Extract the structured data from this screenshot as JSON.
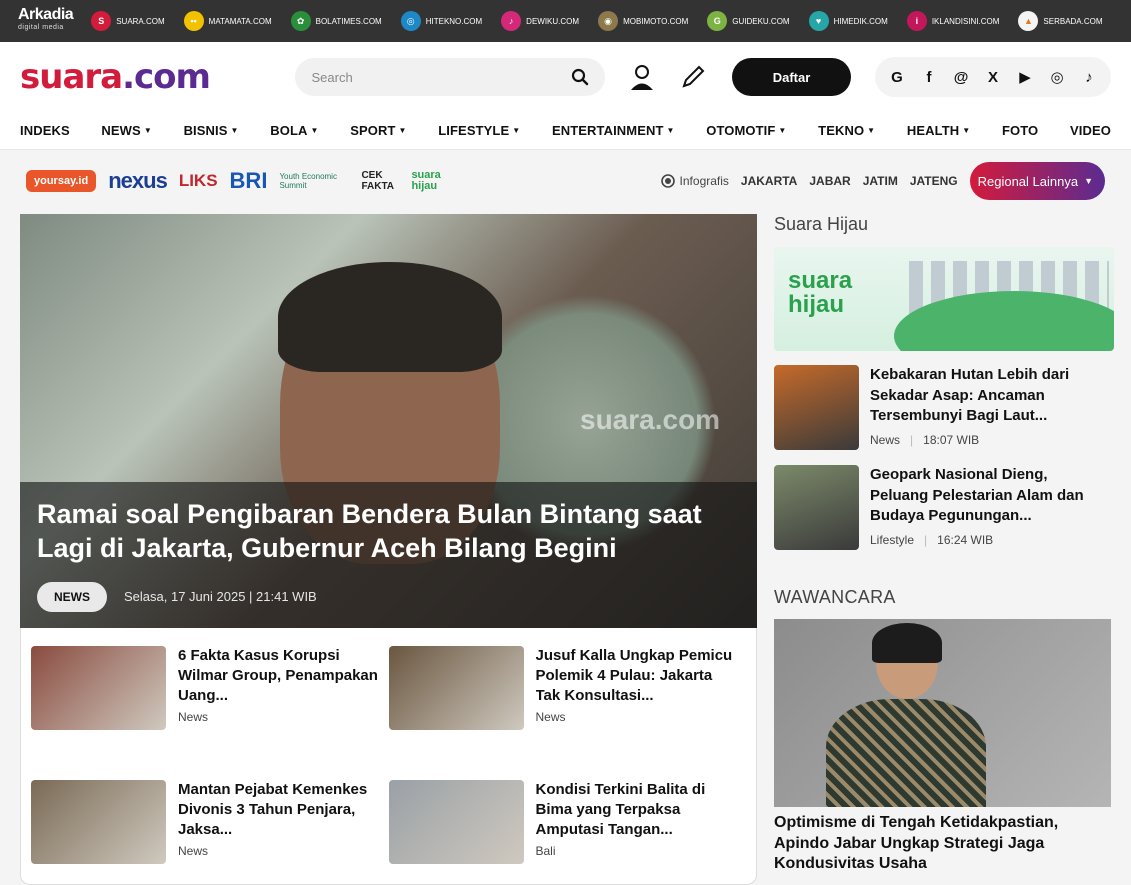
{
  "network": {
    "brand": "Arkadia",
    "brand_sub": "digital media",
    "sites": [
      {
        "label": "SUARA.COM",
        "color": "#d31b3c",
        "glyph": "S"
      },
      {
        "label": "MATAMATA.COM",
        "color": "#f2c200",
        "glyph": "••"
      },
      {
        "label": "BOLATIMES.COM",
        "color": "#2a8f3b",
        "glyph": "✿"
      },
      {
        "label": "HITEKNO.COM",
        "color": "#1e88c7",
        "glyph": "◎"
      },
      {
        "label": "DEWIKU.COM",
        "color": "#d6287a",
        "glyph": "♪"
      },
      {
        "label": "MOBIMOTO.COM",
        "color": "#8d7a4a",
        "glyph": "◉"
      },
      {
        "label": "GUIDEKU.COM",
        "color": "#7cb342",
        "glyph": "G"
      },
      {
        "label": "HIMEDIK.COM",
        "color": "#26a6a6",
        "glyph": "♥"
      },
      {
        "label": "IKLANDISINI.COM",
        "color": "#c2185b",
        "glyph": "i"
      },
      {
        "label": "SERBADA.COM",
        "color": "#f4f4f4",
        "glyph": "▲"
      }
    ]
  },
  "header": {
    "logo_main": "suara",
    "logo_dot": ".com",
    "search_placeholder": "Search",
    "daftar_label": "Daftar",
    "socials": [
      "G",
      "f",
      "@",
      "X",
      "▶",
      "◎",
      "♪"
    ]
  },
  "nav": {
    "items": [
      {
        "label": "INDEKS",
        "chev": ""
      },
      {
        "label": "NEWS",
        "chev": "▼"
      },
      {
        "label": "BISNIS",
        "chev": "▼"
      },
      {
        "label": "BOLA",
        "chev": "▼"
      },
      {
        "label": "SPORT",
        "chev": "▼"
      },
      {
        "label": "LIFESTYLE",
        "chev": "▼"
      },
      {
        "label": "ENTERTAINMENT",
        "chev": "▼"
      },
      {
        "label": "OTOMOTIF",
        "chev": "▼"
      },
      {
        "label": "TEKNO",
        "chev": "▼"
      },
      {
        "label": "HEALTH",
        "chev": "▼"
      },
      {
        "label": "FOTO",
        "chev": ""
      },
      {
        "label": "VIDEO",
        "chev": ""
      }
    ]
  },
  "partners": {
    "yoursay": "yoursay.id",
    "nexus": "nexus",
    "liks": "LIKS",
    "bri": "BRI",
    "youth": "Youth Economic Summit",
    "cekfakta": "CEK FAKTA",
    "suarahijau": "suara hijau",
    "infografis": "Infografis",
    "regions": [
      "JAKARTA",
      "JABAR",
      "JATIM",
      "JATENG"
    ],
    "regional_button": "Regional Lainnya"
  },
  "hero": {
    "title": "Ramai soal Pengibaran Bendera Bulan Bintang saat Lagi di Jakarta, Gubernur Aceh Bilang Begini",
    "category": "NEWS",
    "date": "Selasa, 17 Juni 2025 | 21:41 WIB",
    "watermark": "suara.com"
  },
  "cards": [
    {
      "title": "6 Fakta Kasus Korupsi Wilmar Group, Penampakan Uang...",
      "category": "News",
      "thumb": "#8a4b3f"
    },
    {
      "title": "Jusuf Kalla Ungkap Pemicu Polemik 4 Pulau: Jakarta Tak Konsultasi...",
      "category": "News",
      "thumb": "#6a5640"
    },
    {
      "title": "Mantan Pejabat Kemenkes Divonis 3 Tahun Penjara, Jaksa...",
      "category": "News",
      "thumb": "#7a6a55"
    },
    {
      "title": "Kondisi Terkini Balita di Bima yang Terpaksa Amputasi Tangan...",
      "category": "Bali",
      "thumb": "#9aa0a6"
    }
  ],
  "sidebar": {
    "section_title": "Suara Hijau",
    "banner_label": "suara hijau",
    "items": [
      {
        "title": "Kebakaran Hutan Lebih dari Sekadar Asap: Ancaman Tersembunyi Bagi Laut...",
        "category": "News",
        "time": "18:07 WIB",
        "thumb": "#c66a2a"
      },
      {
        "title": "Geopark Nasional Dieng, Peluang Pelestarian Alam dan Budaya Pegunungan...",
        "category": "Lifestyle",
        "time": "16:24 WIB",
        "thumb": "#7c8a6a"
      }
    ],
    "wawancara_title": "WAWANCARA",
    "wawancara_headline": "Optimisme di Tengah Ketidakpastian, Apindo Jabar Ungkap Strategi Jaga Kondusivitas Usaha"
  }
}
